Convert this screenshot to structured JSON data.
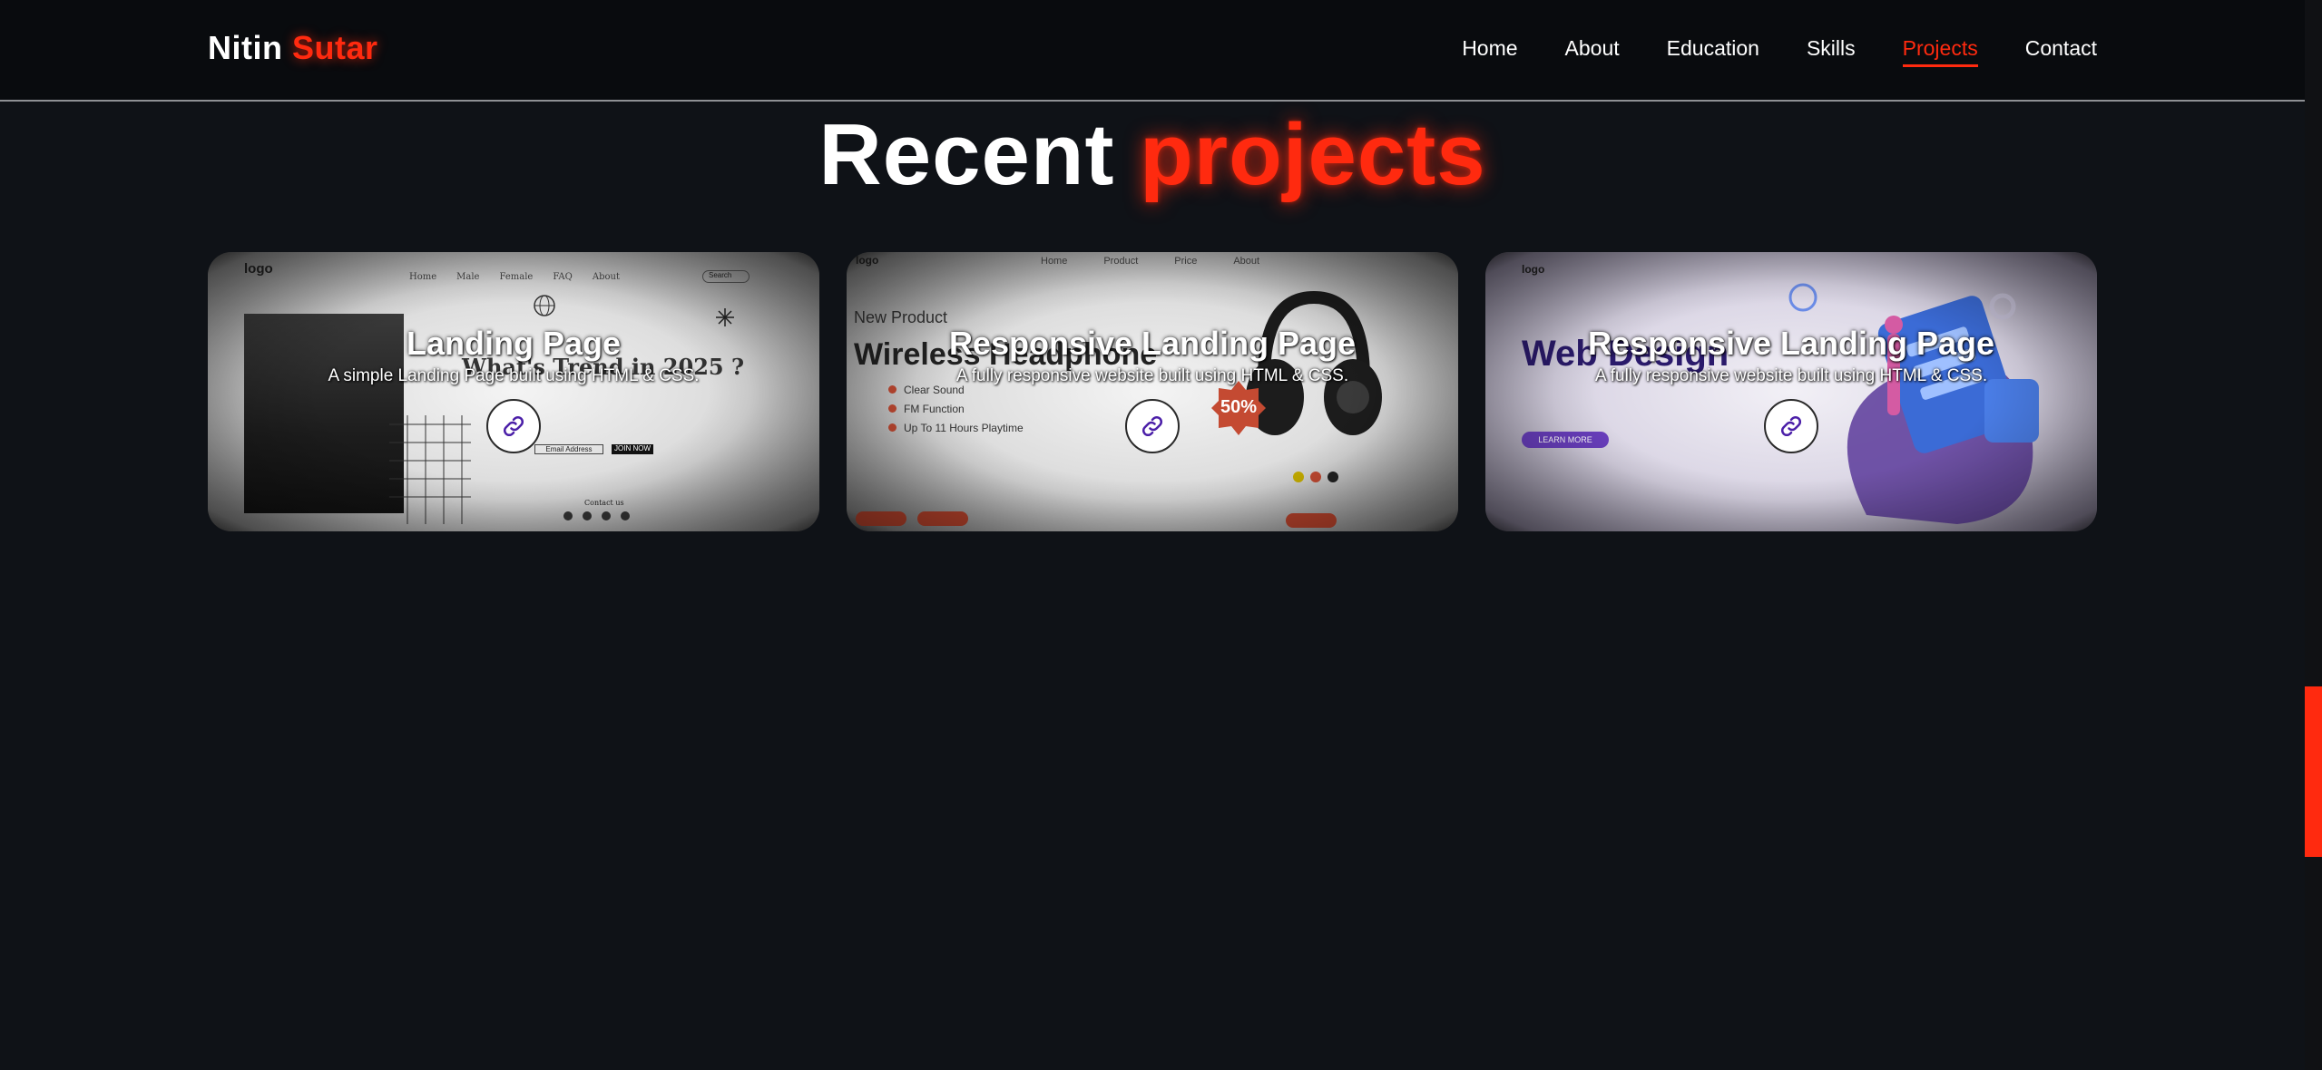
{
  "header": {
    "logo_first": "Nitin",
    "logo_second": "Sutar",
    "nav": [
      {
        "label": "Home",
        "active": false
      },
      {
        "label": "About",
        "active": false
      },
      {
        "label": "Education",
        "active": false
      },
      {
        "label": "Skills",
        "active": false
      },
      {
        "label": "Projects",
        "active": true
      },
      {
        "label": "Contact",
        "active": false
      }
    ]
  },
  "section": {
    "title_first": "Recent",
    "title_second": "projects"
  },
  "projects": [
    {
      "title": "Landing Page",
      "description": "A simple Landing Page built using HTML & CSS.",
      "link_icon": "link-icon",
      "preview": {
        "logo": "logo",
        "nav": [
          "Home",
          "Male",
          "Female",
          "FAQ",
          "About"
        ],
        "search": "Search",
        "headline": "What's Trend in 2025 ?",
        "email_placeholder": "Email Address",
        "cta": "JOIN NOW",
        "contact": "Contact us"
      }
    },
    {
      "title": "Responsive Landing Page",
      "description": "A fully responsive website built using HTML & CSS.",
      "link_icon": "link-icon",
      "preview": {
        "logo": "logo",
        "nav": [
          "Home",
          "Product",
          "Price",
          "About"
        ],
        "kicker": "New Product",
        "headline": "Wireless Headphone",
        "features": [
          "Clear Sound",
          "FM Function",
          "Up To 11 Hours Playtime"
        ],
        "badge": "50%"
      }
    },
    {
      "title": "Responsive Landing Page",
      "description": "A fully responsive website built using HTML & CSS.",
      "link_icon": "link-icon",
      "preview": {
        "logo": "logo",
        "headline": "Web Design",
        "cta": "LEARN MORE"
      }
    }
  ],
  "colors": {
    "accent": "#ff2a0f",
    "background": "#0f1217",
    "header_bg": "#090b0e"
  }
}
